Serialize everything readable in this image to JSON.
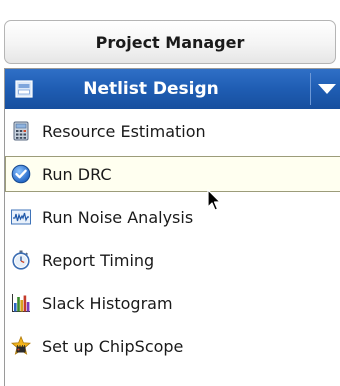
{
  "project_manager": {
    "label": "Project Manager"
  },
  "section": {
    "title": "Netlist Design",
    "icon": "netlist-design-icon"
  },
  "items": [
    {
      "label": "Resource Estimation",
      "icon": "calculator-icon"
    },
    {
      "label": "Run DRC",
      "icon": "drc-check-icon",
      "selected": true
    },
    {
      "label": "Run Noise Analysis",
      "icon": "waveform-icon"
    },
    {
      "label": "Report Timing",
      "icon": "stopwatch-icon"
    },
    {
      "label": "Slack Histogram",
      "icon": "histogram-icon"
    },
    {
      "label": "Set up ChipScope",
      "icon": "chipscope-icon"
    }
  ],
  "colors": {
    "header_blue": "#1f5db3",
    "selection_bg": "#fffff0"
  }
}
